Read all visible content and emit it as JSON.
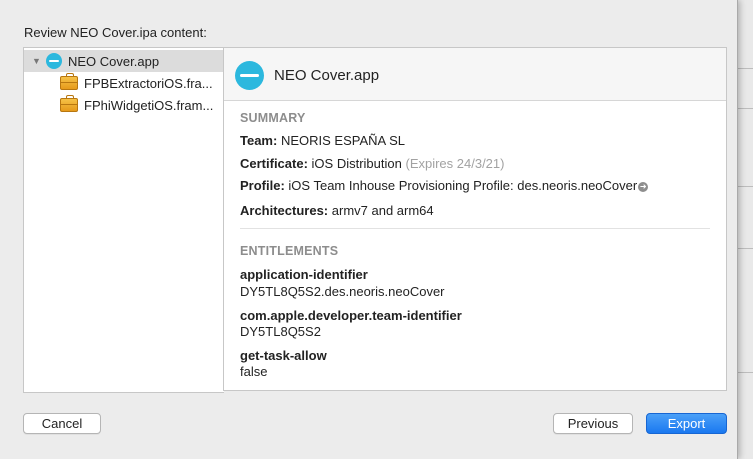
{
  "dialog": {
    "title": "Review NEO Cover.ipa content:"
  },
  "sidebar": {
    "items": [
      {
        "label": "NEO Cover.app"
      },
      {
        "label": "FPBExtractoriOS.fra..."
      },
      {
        "label": "FPhiWidgetiOS.fram..."
      }
    ]
  },
  "detail": {
    "app_name": "NEO Cover.app",
    "summary": {
      "heading": "SUMMARY",
      "team_label": "Team:",
      "team_value": "NEORIS ESPAÑA SL",
      "certificate_label": "Certificate:",
      "certificate_value": "iOS Distribution",
      "certificate_expiry": "(Expires 24/3/21)",
      "profile_label": "Profile:",
      "profile_value": "iOS Team Inhouse Provisioning Profile: des.neoris.neoCover",
      "architectures_label": "Architectures:",
      "architectures_value": "armv7 and arm64"
    },
    "entitlements": {
      "heading": "ENTITLEMENTS",
      "items": [
        {
          "key": "application-identifier",
          "value": "DY5TL8Q5S2.des.neoris.neoCover"
        },
        {
          "key": "com.apple.developer.team-identifier",
          "value": "DY5TL8Q5S2"
        },
        {
          "key": "get-task-allow",
          "value": "false"
        }
      ]
    }
  },
  "buttons": {
    "cancel": "Cancel",
    "previous": "Previous",
    "export": "Export"
  },
  "colors": {
    "accent": "#1a78f0",
    "app_icon": "#2cb8de",
    "muted_text": "#a2a2a2",
    "section_heading": "#8d8d8d"
  },
  "icons": {
    "app": "app-icon",
    "framework": "toolbox-icon",
    "disclosure": "disclosure-triangle-icon",
    "profile_link": "arrow-right-circle-icon"
  }
}
